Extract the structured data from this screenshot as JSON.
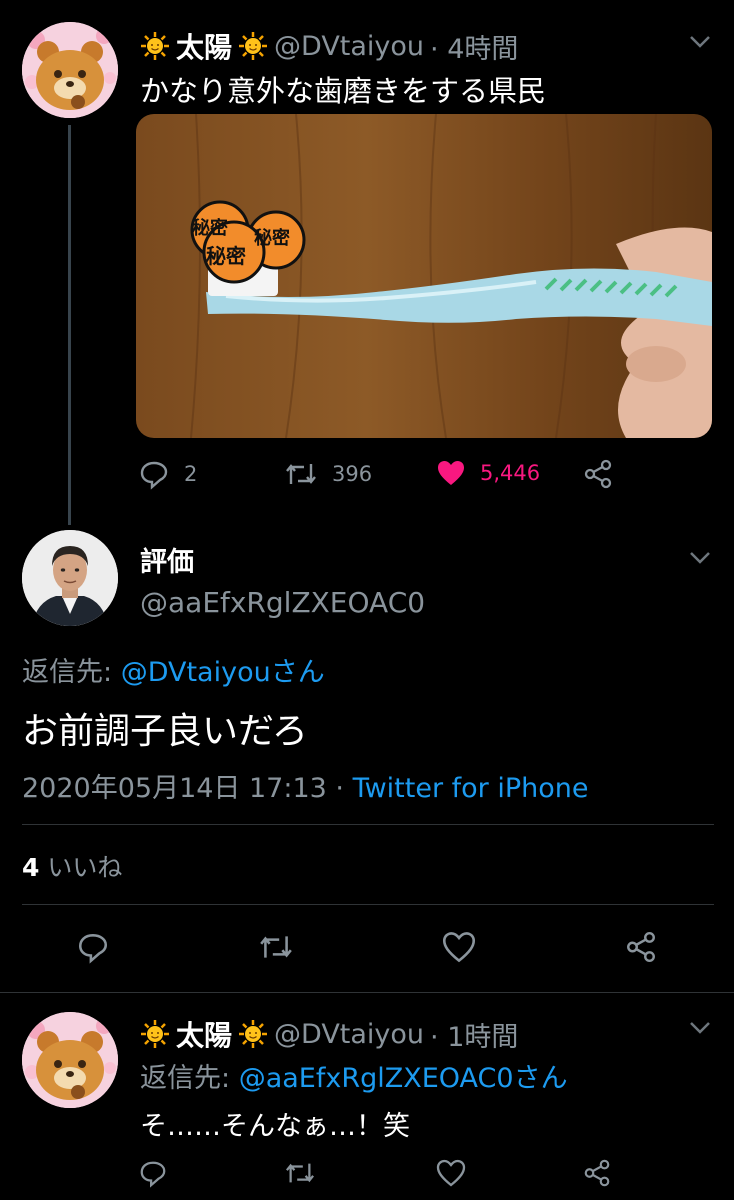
{
  "tweet1": {
    "name": "太陽",
    "handle": "@DVtaiyou",
    "time": "· 4時間",
    "text": "かなり意外な歯磨きをする県民",
    "image_stickers": [
      "秘密",
      "秘密",
      "秘密"
    ],
    "replies": "2",
    "retweets": "396",
    "likes": "5,446"
  },
  "reply": {
    "name": "評価",
    "handle": "@aaEfxRglZXEOAC0",
    "reply_to_prefix": "返信先: ",
    "reply_to_user": "@DVtaiyouさん",
    "text": "お前調子良いだろ",
    "timestamp": "2020年05月14日 17:13 · ",
    "client": "Twitter for iPhone",
    "like_count": "4",
    "like_label": "いいね"
  },
  "tweet2": {
    "name": "太陽",
    "handle": "@DVtaiyou",
    "time": "· 1時間",
    "reply_to_prefix": "返信先: ",
    "reply_to_user": "@aaEfxRglZXEOAC0さん",
    "text": "そ……そんなぁ…！笑"
  },
  "colors": {
    "accent": "#1d9bf0",
    "like": "#f91880",
    "muted": "#8a949c"
  },
  "icons": [
    "sun-icon",
    "chevron-down-icon",
    "reply-icon",
    "retweet-icon",
    "heart-icon",
    "share-icon"
  ]
}
